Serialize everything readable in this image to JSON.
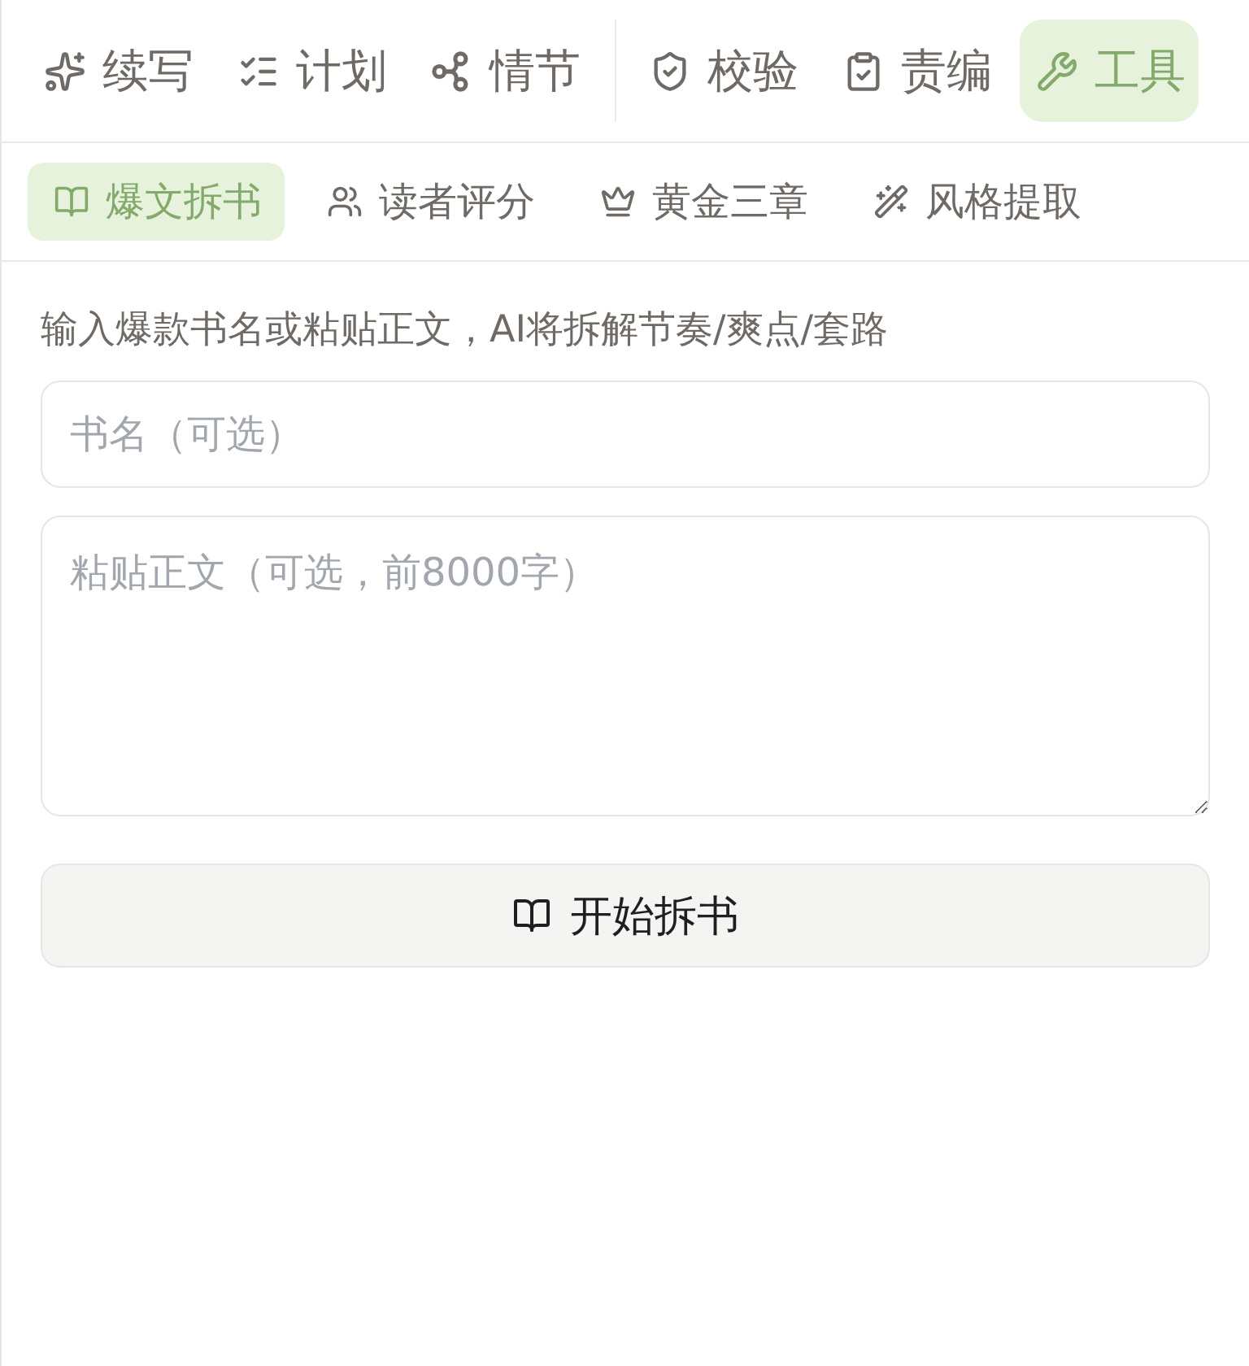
{
  "tab_groups": [
    {
      "tabs": [
        {
          "label": "续写",
          "selected": false
        },
        {
          "label": "计划",
          "selected": false
        },
        {
          "label": "情节",
          "selected": false
        }
      ]
    },
    {
      "tabs": [
        {
          "label": "校验",
          "selected": false
        },
        {
          "label": "责编",
          "selected": false
        },
        {
          "label": "工具",
          "selected": true
        }
      ]
    }
  ],
  "sub_tabs": [
    {
      "label": "爆文拆书",
      "selected": true
    },
    {
      "label": "读者评分",
      "selected": false
    },
    {
      "label": "黄金三章",
      "selected": false
    },
    {
      "label": "风格提取",
      "selected": false
    }
  ],
  "description": "输入爆款书名或粘贴正文，AI将拆解节奏/爽点/套路",
  "title_field": {
    "placeholder": "书名（可选）"
  },
  "text_field": {
    "placeholder": "粘贴正文（可选，前8000字）"
  },
  "start_button": {
    "label": "开始拆书"
  }
}
